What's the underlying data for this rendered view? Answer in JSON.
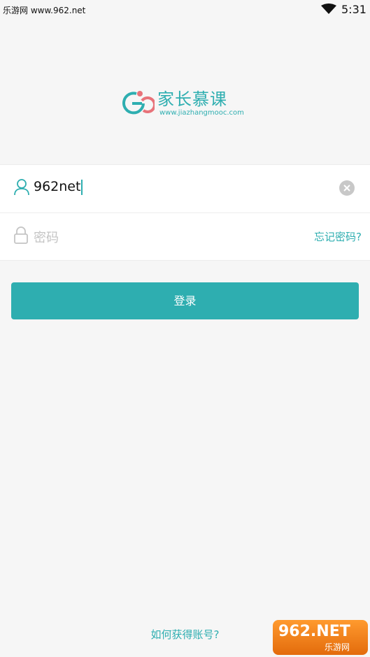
{
  "status_bar": {
    "carrier": "乐游网 www.962.net",
    "time": "5:31"
  },
  "logo": {
    "name": "家长慕课",
    "url": "www.jiazhangmooc.com"
  },
  "form": {
    "username_value": "962net",
    "password_placeholder": "密码",
    "forgot_label": "忘记密码?"
  },
  "login_button": "登录",
  "get_account_link": "如何获得账号?",
  "watermark": {
    "big": "962.NET",
    "small": "乐游网"
  },
  "colors": {
    "accent": "#2eaeb0",
    "background": "#f6f6f6"
  }
}
